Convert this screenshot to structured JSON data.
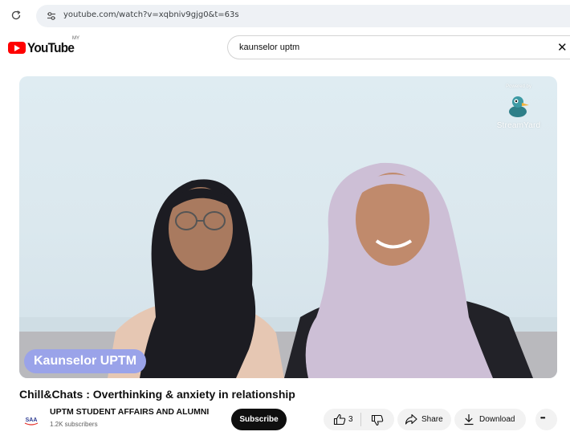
{
  "browser": {
    "url": "youtube.com/watch?v=xqbniv9gjg0&t=63s"
  },
  "header": {
    "logo_text": "YouTube",
    "region": "MY",
    "search_query": "kaunselor uptm",
    "clear_symbol": "✕"
  },
  "video": {
    "watermark_powered": "Powered by",
    "watermark_brand": "StreamYard",
    "lower_third": "Kaunselor UPTM",
    "title": "Chill&Chats : Overthinking & anxiety in relationship"
  },
  "channel": {
    "name": "UPTM STUDENT AFFAIRS AND ALUMNI",
    "subscribers": "1.2K subscribers",
    "subscribe_label": "Subscribe"
  },
  "actions": {
    "like_count": "3",
    "share_label": "Share",
    "download_label": "Download",
    "more_symbol": "•••"
  },
  "icons": [
    "reload-icon",
    "site-info-icon",
    "youtube-logo-icon",
    "clear-icon",
    "duck-icon",
    "thumbs-up-icon",
    "thumbs-down-icon",
    "share-icon",
    "download-icon",
    "more-icon"
  ],
  "colors": {
    "brand_red": "#ff0000",
    "subscribe_bg": "#0f0f0f",
    "lower_third_bg": "#9aa3e9",
    "pill_bg": "#f2f2f2"
  }
}
